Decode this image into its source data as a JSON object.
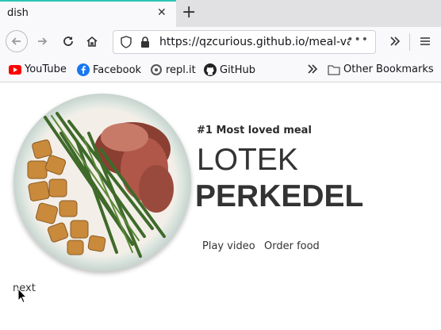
{
  "tab": {
    "title": "dish",
    "close_icon": "close-icon",
    "new_tab_icon": "plus-icon"
  },
  "nav": {
    "url": "https://qzcurious.github.io/meal-van",
    "overflow_dots": "•••"
  },
  "bookmarks": [
    {
      "label": "YouTube",
      "icon": "youtube-icon"
    },
    {
      "label": "Facebook",
      "icon": "facebook-icon"
    },
    {
      "label": "repl.it",
      "icon": "replit-icon"
    },
    {
      "label": "GitHub",
      "icon": "github-icon"
    }
  ],
  "other_bookmarks": "Other Bookmarks",
  "hero": {
    "tagline": "#1 Most loved meal",
    "title_light": "LOTEK",
    "title_bold": "PERKEDEL",
    "play_label": "Play video",
    "order_label": "Order food"
  },
  "next_label": "next",
  "colors": {
    "accent": "#2ec4b6",
    "youtube": "#ff0000",
    "facebook": "#1877f2"
  }
}
